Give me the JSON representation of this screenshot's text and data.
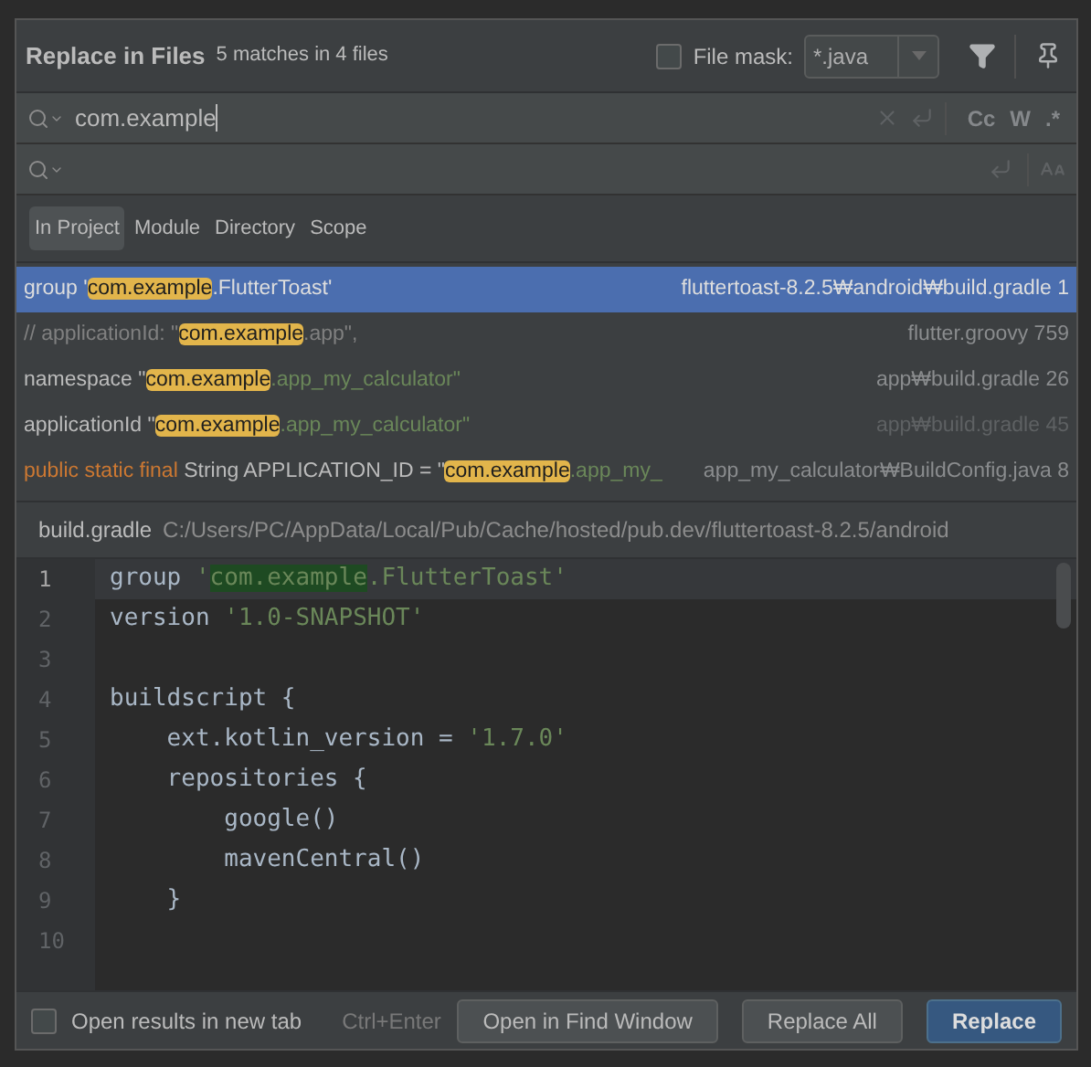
{
  "dialog": {
    "title": "Replace in Files",
    "match_count": "5 matches in 4 files",
    "file_mask": {
      "label": "File mask:",
      "checked": false,
      "value": "*.java"
    }
  },
  "search": {
    "value": "com.example",
    "toggles": [
      {
        "label": "Cc",
        "selected": false
      },
      {
        "label": "W",
        "selected": false
      },
      {
        "label": ".*",
        "selected": false
      }
    ]
  },
  "scopes": [
    {
      "label": "In Project",
      "selected": true
    },
    {
      "label": "Module",
      "selected": false
    },
    {
      "label": "Directory",
      "selected": false
    },
    {
      "label": "Scope",
      "selected": false
    }
  ],
  "results": [
    {
      "selected": true,
      "dimmed": false,
      "segments": [
        {
          "kind": "plain",
          "text": "group '"
        },
        {
          "kind": "match",
          "text": "com.example"
        },
        {
          "kind": "plain",
          "text": ".FlutterToast'"
        }
      ],
      "file": "fluttertoast-8.2.5₩android₩build.gradle 1"
    },
    {
      "selected": false,
      "dimmed": false,
      "segments": [
        {
          "kind": "comment",
          "text": "//   applicationId: \""
        },
        {
          "kind": "match",
          "text": "com.example"
        },
        {
          "kind": "comment",
          "text": ".app\","
        }
      ],
      "file": "flutter.groovy 759"
    },
    {
      "selected": false,
      "dimmed": false,
      "segments": [
        {
          "kind": "plain",
          "text": "namespace \""
        },
        {
          "kind": "match",
          "text": "com.example"
        },
        {
          "kind": "string",
          "text": ".app_my_calculator\""
        }
      ],
      "file": "app₩build.gradle 26"
    },
    {
      "selected": false,
      "dimmed": true,
      "segments": [
        {
          "kind": "plain",
          "text": "applicationId \""
        },
        {
          "kind": "match",
          "text": "com.example"
        },
        {
          "kind": "string",
          "text": ".app_my_calculator\""
        }
      ],
      "file": "app₩build.gradle 45"
    },
    {
      "selected": false,
      "dimmed": false,
      "segments": [
        {
          "kind": "keyword",
          "text": "public static final "
        },
        {
          "kind": "plain",
          "text": "String APPLICATION_ID = \""
        },
        {
          "kind": "match",
          "text": "com.example"
        },
        {
          "kind": "string",
          "text": ".app_my_"
        }
      ],
      "file": "app_my_calculator₩BuildConfig.java 8"
    }
  ],
  "preview": {
    "file": "build.gradle",
    "path": "C:/Users/PC/AppData/Local/Pub/Cache/hosted/pub.dev/fluttertoast-8.2.5/android",
    "lines": [
      {
        "number": "1",
        "current": true,
        "segments": [
          {
            "kind": "plain",
            "text": "group "
          },
          {
            "kind": "string",
            "text": "'"
          },
          {
            "kind": "match",
            "text": "com.example"
          },
          {
            "kind": "string",
            "text": ".FlutterToast'"
          }
        ]
      },
      {
        "number": "2",
        "current": false,
        "segments": [
          {
            "kind": "plain",
            "text": "version "
          },
          {
            "kind": "string",
            "text": "'1.0-SNAPSHOT'"
          }
        ]
      },
      {
        "number": "3",
        "current": false
      },
      {
        "number": "4",
        "current": false,
        "segments": [
          {
            "kind": "plain",
            "text": "buildscript {"
          }
        ]
      },
      {
        "number": "5",
        "current": false,
        "segments": [
          {
            "kind": "plain",
            "text": "    ext.kotlin_version = "
          },
          {
            "kind": "string",
            "text": "'1.7.0'"
          }
        ]
      },
      {
        "number": "6",
        "current": false,
        "segments": [
          {
            "kind": "plain",
            "text": "    repositories {"
          }
        ]
      },
      {
        "number": "7",
        "current": false,
        "segments": [
          {
            "kind": "plain",
            "text": "        google()"
          }
        ]
      },
      {
        "number": "8",
        "current": false,
        "segments": [
          {
            "kind": "plain",
            "text": "        mavenCentral()"
          }
        ]
      },
      {
        "number": "9",
        "current": false,
        "segments": [
          {
            "kind": "plain",
            "text": "    }"
          }
        ]
      },
      {
        "number": "10",
        "current": false
      }
    ]
  },
  "footer": {
    "new_tab": {
      "label": "Open results in new tab",
      "checked": false
    },
    "shortcut": "Ctrl+Enter",
    "buttons": [
      {
        "label": "Open in Find Window",
        "kind": "secondary"
      },
      {
        "label": "Replace All",
        "kind": "secondary"
      },
      {
        "label": "Replace",
        "kind": "primary"
      }
    ]
  }
}
